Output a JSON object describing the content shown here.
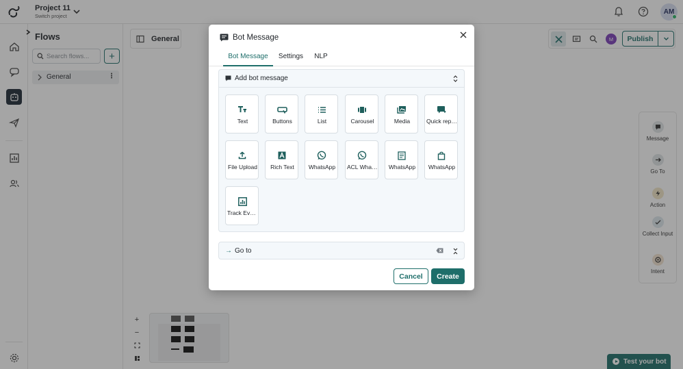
{
  "topbar": {
    "project_name": "Project 11",
    "project_sub": "Switch project",
    "avatar_initials": "AM",
    "logo_icon": "loop-logo-icon",
    "bell_icon": "bell-icon",
    "help_icon": "help-icon"
  },
  "rail": {
    "items": [
      "home-icon",
      "chat-icon",
      "bot-icon",
      "send-icon",
      "analytics-icon",
      "users-icon",
      "settings-icon"
    ],
    "active": "bot-icon"
  },
  "flows": {
    "title": "Flows",
    "search_placeholder": "Search flows...",
    "items": [
      {
        "label": "General"
      }
    ]
  },
  "canvas": {
    "tab_label": "General",
    "publish_label": "Publish",
    "user_avatar": "M",
    "palette": [
      {
        "label": "Message",
        "icon": "message-icon"
      },
      {
        "label": "Go To",
        "icon": "arrow-right-icon"
      },
      {
        "label": "Action",
        "icon": "lightning-icon"
      },
      {
        "label": "Collect Input",
        "icon": "check-icon"
      },
      {
        "label": "Intent",
        "icon": "target-icon"
      }
    ],
    "zoom": [
      "+",
      "−"
    ],
    "test_bot_label": "Test your bot"
  },
  "modal": {
    "title": "Bot Message",
    "tabs": [
      {
        "label": "Bot Message",
        "active": true
      },
      {
        "label": "Settings",
        "active": false
      },
      {
        "label": "NLP",
        "active": false
      }
    ],
    "section_title": "Add bot message",
    "cards": [
      {
        "label": "Text",
        "icon": "text-icon"
      },
      {
        "label": "Buttons",
        "icon": "buttons-icon"
      },
      {
        "label": "List",
        "icon": "list-icon"
      },
      {
        "label": "Carousel",
        "icon": "carousel-icon"
      },
      {
        "label": "Media",
        "icon": "media-icon"
      },
      {
        "label": "Quick replies",
        "icon": "quick-reply-icon"
      },
      {
        "label": "File Upload",
        "icon": "upload-icon"
      },
      {
        "label": "Rich Text",
        "icon": "rich-text-icon"
      },
      {
        "label": "WhatsApp",
        "icon": "whatsapp-icon"
      },
      {
        "label": "ACL WhatsApp",
        "icon": "whatsapp-icon"
      },
      {
        "label": "WhatsApp",
        "icon": "whatsapp-form-icon"
      },
      {
        "label": "WhatsApp",
        "icon": "whatsapp-bag-icon"
      },
      {
        "label": "Track Event",
        "icon": "track-event-icon"
      }
    ],
    "goto_label": "Go to",
    "cancel_label": "Cancel",
    "create_label": "Create"
  },
  "colors": {
    "accent": "#1e6e6a",
    "overlay": "rgba(40,40,40,0.42)",
    "avatar_purple": "#7b3fb8"
  }
}
